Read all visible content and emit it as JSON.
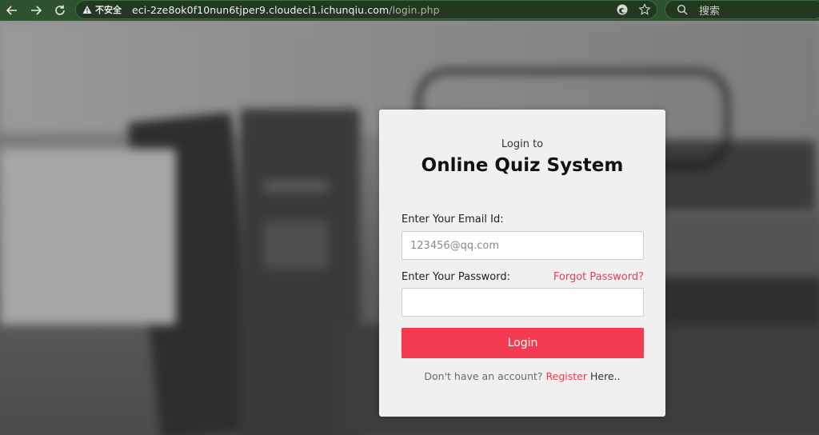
{
  "browser": {
    "insecure_label": "不安全",
    "url_host": "eci-2ze8ok0f10nun6tjper9.cloudeci1.ichunqiu.com",
    "url_path": "/login.php",
    "search_placeholder": "搜索"
  },
  "login": {
    "pre_title": "Login to",
    "title": "Online Quiz System",
    "email_label": "Enter Your Email Id:",
    "email_placeholder": "123456@qq.com",
    "password_label": "Enter Your Password:",
    "forgot_label": "Forgot Password?",
    "button_label": "Login",
    "footer_prefix": "Don't have an account?",
    "register_label": "Register",
    "footer_suffix": "Here.."
  },
  "colors": {
    "accent": "#f43b52",
    "chrome": "#2e5130",
    "card": "#f0f0f0"
  }
}
